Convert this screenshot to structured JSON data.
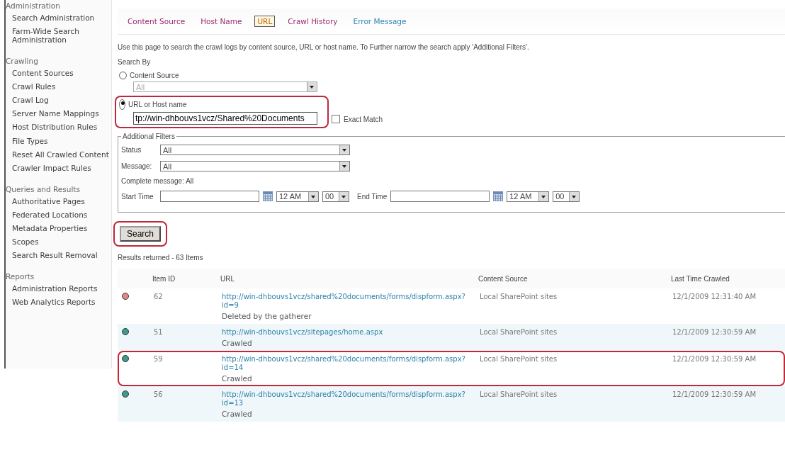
{
  "sidebar": {
    "sections": [
      {
        "heading": "Administration",
        "items": [
          "Search Administration",
          "Farm-Wide Search Administration"
        ]
      },
      {
        "heading": "Crawling",
        "items": [
          "Content Sources",
          "Crawl Rules",
          "Crawl Log",
          "Server Name Mappings",
          "Host Distribution Rules",
          "File Types",
          "Reset All Crawled Content",
          "Crawler Impact Rules"
        ]
      },
      {
        "heading": "Queries and Results",
        "items": [
          "Authoritative Pages",
          "Federated Locations",
          "Metadata Properties",
          "Scopes",
          "Search Result Removal"
        ]
      },
      {
        "heading": "Reports",
        "items": [
          "Administration Reports",
          "Web Analytics Reports"
        ]
      }
    ]
  },
  "tabs": [
    {
      "label": "Content Source",
      "selected": false,
      "color": "#9b2a6e"
    },
    {
      "label": "Host Name",
      "selected": false,
      "color": "#9b2a6e"
    },
    {
      "label": "URL",
      "selected": true,
      "color": "#b8650a"
    },
    {
      "label": "Crawl History",
      "selected": false,
      "color": "#9b2a6e"
    },
    {
      "label": "Error Message",
      "selected": false,
      "color": "#2f86b4"
    }
  ],
  "intro": "Use this page to search the crawl logs by content source, URL or host name. To Further narrow the search apply 'Additional Filters'.",
  "search_by": {
    "label": "Search By",
    "options": [
      {
        "label": "Content Source",
        "selected": false,
        "highlighted": false,
        "kind": "select",
        "value": "All"
      },
      {
        "label": "URL or Host name",
        "selected": true,
        "highlighted": true,
        "kind": "text",
        "value": "tp://win-dhbouvs1vcz/Shared%20Documents"
      }
    ],
    "exact_match": {
      "label": "Exact Match",
      "checked": false
    }
  },
  "filters": {
    "legend": "Additional Filters",
    "status": {
      "label": "Status",
      "value": "All"
    },
    "message": {
      "label": "Message:",
      "value": "All"
    },
    "complete_message": "Complete message: All",
    "start": {
      "label": "Start Time",
      "hour": "12 AM",
      "minute": "00"
    },
    "end": {
      "label": "End Time",
      "hour": "12 AM",
      "minute": "00"
    }
  },
  "search_button": {
    "label": "Search",
    "highlighted": true
  },
  "results_count": "Results returned - 63 Items",
  "table": {
    "columns": [
      "Item ID",
      "URL",
      "Content Source",
      "Last Time Crawled"
    ],
    "rows": [
      {
        "color": "#e08a8a",
        "id": "62",
        "url": "http://win-dhbouvs1vcz/shared%20documents/forms/dispform.aspx?id=9",
        "message": "Deleted by the gatherer",
        "source": "Local SharePoint sites",
        "time": "12/1/2009 12:31:40 AM",
        "highlighted": false
      },
      {
        "color": "#3f9a8a",
        "id": "51",
        "url": "http://win-dhbouvs1vcz/sitepages/home.aspx",
        "message": "Crawled",
        "source": "Local SharePoint sites",
        "time": "12/1/2009 12:30:59 AM",
        "highlighted": false
      },
      {
        "color": "#3f9a8a",
        "id": "59",
        "url": "http://win-dhbouvs1vcz/shared%20documents/forms/dispform.aspx?id=14",
        "message": "Crawled",
        "source": "Local SharePoint sites",
        "time": "12/1/2009 12:30:59 AM",
        "highlighted": true
      },
      {
        "color": "#3f9a8a",
        "id": "56",
        "url": "http://win-dhbouvs1vcz/shared%20documents/forms/dispform.aspx?id=13",
        "message": "Crawled",
        "source": "Local SharePoint sites",
        "time": "12/1/2009 12:30:59 AM",
        "highlighted": false
      }
    ]
  }
}
